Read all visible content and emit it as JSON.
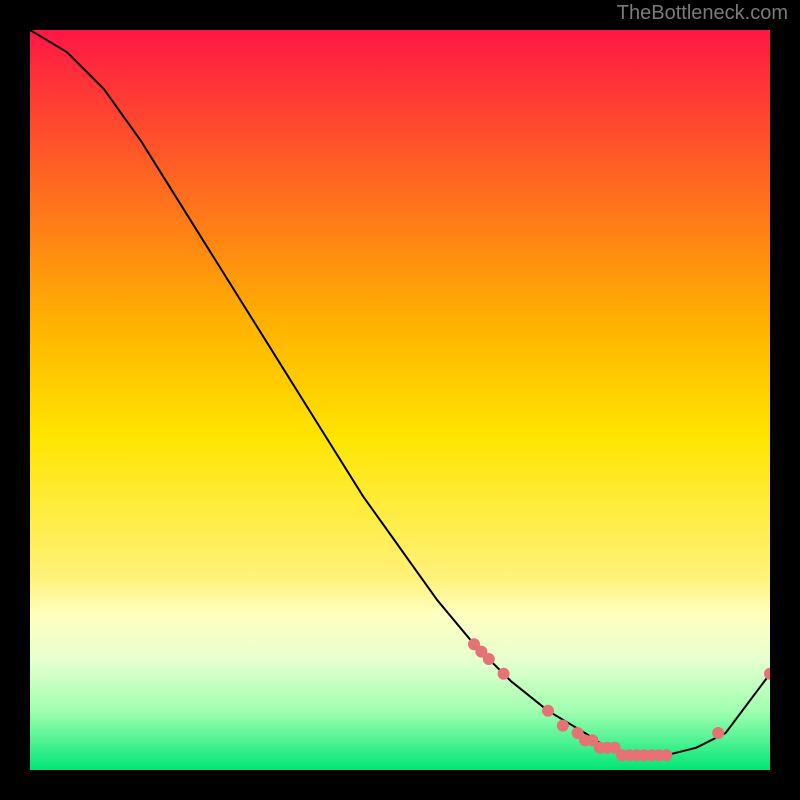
{
  "attribution": "TheBottleneck.com",
  "chart_data": {
    "type": "line",
    "title": "",
    "xlabel": "",
    "ylabel": "",
    "xlim": [
      0,
      100
    ],
    "ylim": [
      0,
      100
    ],
    "background_gradient": {
      "stops": [
        {
          "offset": 0,
          "color": "#ff1744"
        },
        {
          "offset": 40,
          "color": "#ffb300"
        },
        {
          "offset": 55,
          "color": "#ffe500"
        },
        {
          "offset": 74,
          "color": "#fff27a"
        },
        {
          "offset": 79,
          "color": "#ffffc0"
        },
        {
          "offset": 85,
          "color": "#e8ffd0"
        },
        {
          "offset": 92,
          "color": "#a0ffb0"
        },
        {
          "offset": 100,
          "color": "#00e676"
        }
      ]
    },
    "series": [
      {
        "name": "curve",
        "type": "line",
        "color": "#000000",
        "width": 2,
        "x": [
          0,
          5,
          10,
          15,
          20,
          25,
          30,
          35,
          40,
          45,
          50,
          55,
          60,
          65,
          70,
          75,
          78,
          82,
          86,
          90,
          94,
          100
        ],
        "y": [
          100,
          97,
          92,
          85,
          77,
          69,
          61,
          53,
          45,
          37,
          30,
          23,
          17,
          12,
          8,
          5,
          3,
          2,
          2,
          3,
          5,
          13
        ]
      },
      {
        "name": "markers",
        "type": "scatter",
        "color": "#e57373",
        "radius": 6,
        "x": [
          60,
          61,
          62,
          64,
          70,
          72,
          74,
          75,
          76,
          77,
          78,
          79,
          80,
          81,
          82,
          83,
          84,
          85,
          86,
          93,
          100
        ],
        "y": [
          17,
          16,
          15,
          13,
          8,
          6,
          5,
          4,
          4,
          3,
          3,
          3,
          2,
          2,
          2,
          2,
          2,
          2,
          2,
          5,
          13
        ]
      }
    ]
  }
}
